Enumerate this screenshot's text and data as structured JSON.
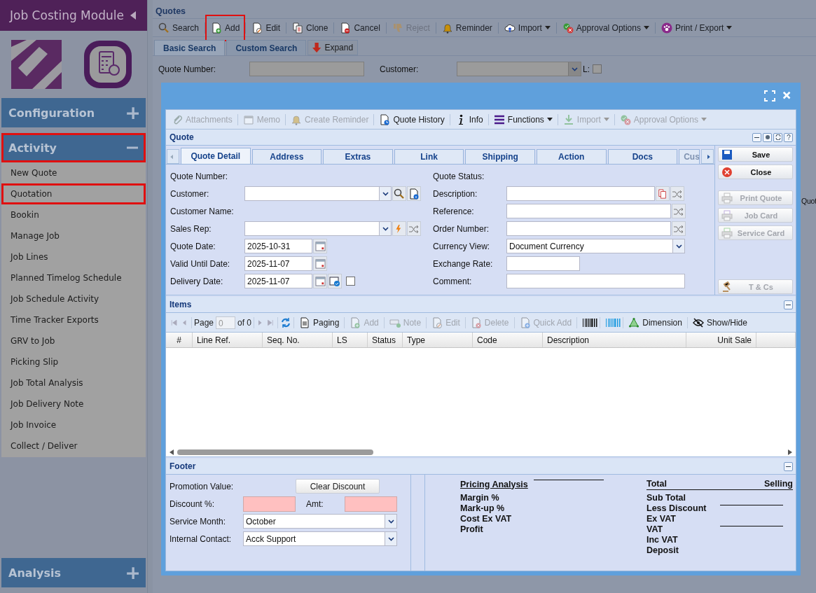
{
  "sidebar": {
    "title": "Job Costing Module",
    "sections": [
      {
        "label": "Configuration",
        "expanded": false,
        "highlighted": false
      },
      {
        "label": "Activity",
        "expanded": true,
        "highlighted": true,
        "items": [
          {
            "label": "New Quote",
            "highlighted": false
          },
          {
            "label": "Quotation",
            "highlighted": true
          },
          {
            "label": "Bookin",
            "highlighted": false
          },
          {
            "label": "Manage Job",
            "highlighted": false
          },
          {
            "label": "Job Lines",
            "highlighted": false
          },
          {
            "label": "Planned Timelog Schedule",
            "highlighted": false
          },
          {
            "label": "Job Schedule Activity",
            "highlighted": false
          },
          {
            "label": "Time Tracker Exports",
            "highlighted": false
          },
          {
            "label": "GRV to Job",
            "highlighted": false
          },
          {
            "label": "Picking Slip",
            "highlighted": false
          },
          {
            "label": "Job Total Analysis",
            "highlighted": false
          },
          {
            "label": "Job Delivery Note",
            "highlighted": false
          },
          {
            "label": "Job Invoice",
            "highlighted": false
          },
          {
            "label": "Collect / Deliver",
            "highlighted": false
          }
        ]
      },
      {
        "label": "Analysis",
        "expanded": false,
        "highlighted": false
      }
    ]
  },
  "main": {
    "title": "Quotes",
    "toolbar": [
      {
        "label": "Search",
        "disabled": false,
        "dropdown": false,
        "highlighted": false
      },
      {
        "label": "Add",
        "disabled": false,
        "dropdown": false,
        "highlighted": true
      },
      {
        "label": "Edit",
        "disabled": false,
        "dropdown": false,
        "highlighted": false
      },
      {
        "label": "Clone",
        "disabled": false,
        "dropdown": false,
        "highlighted": false
      },
      {
        "label": "Cancel",
        "disabled": false,
        "dropdown": false,
        "highlighted": false
      },
      {
        "label": "Reject",
        "disabled": true,
        "dropdown": false,
        "highlighted": false
      },
      {
        "label": "Reminder",
        "disabled": false,
        "dropdown": false,
        "highlighted": false
      },
      {
        "label": "Import",
        "disabled": false,
        "dropdown": true,
        "highlighted": false
      },
      {
        "label": "Approval Options",
        "disabled": false,
        "dropdown": true,
        "highlighted": false
      },
      {
        "label": "Print / Export",
        "disabled": false,
        "dropdown": true,
        "highlighted": false
      }
    ],
    "search_tabs": [
      {
        "label": "Basic Search",
        "selected": true
      },
      {
        "label": "Custom Search",
        "selected": false
      }
    ],
    "expand_button": "Expand",
    "search_form": {
      "quote_number_label": "Quote Number:",
      "customer_label": "Customer:",
      "l_label": "L:",
      "l_checked": false
    },
    "cut_column": "Quot"
  },
  "dialog": {
    "toolbar": [
      {
        "label": "Attachments",
        "disabled": true,
        "dropdown": false
      },
      {
        "label": "Memo",
        "disabled": true,
        "dropdown": false
      },
      {
        "label": "Create Reminder",
        "disabled": true,
        "dropdown": false
      },
      {
        "label": "Quote History",
        "disabled": false,
        "dropdown": false
      },
      {
        "label": "Info",
        "disabled": false,
        "dropdown": false
      },
      {
        "label": "Functions",
        "disabled": false,
        "dropdown": true
      },
      {
        "label": "Import",
        "disabled": true,
        "dropdown": true
      },
      {
        "label": "Approval Options",
        "disabled": true,
        "dropdown": true
      }
    ],
    "quote_panel": {
      "title": "Quote",
      "tabs": [
        {
          "label": "Quote Detail",
          "selected": true
        },
        {
          "label": "Address",
          "selected": false
        },
        {
          "label": "Extras",
          "selected": false
        },
        {
          "label": "Link",
          "selected": false
        },
        {
          "label": "Shipping",
          "selected": false
        },
        {
          "label": "Action",
          "selected": false
        },
        {
          "label": "Docs",
          "selected": false
        },
        {
          "label": "Cus",
          "selected": false
        }
      ],
      "left_fields": [
        {
          "kind": "label",
          "label": "Quote Number:"
        },
        {
          "kind": "combo",
          "label": "Customer:"
        },
        {
          "kind": "label",
          "label": "Customer Name:"
        },
        {
          "kind": "combo",
          "label": "Sales Rep:"
        },
        {
          "kind": "date",
          "label": "Quote Date:",
          "value": "2025-10-31"
        },
        {
          "kind": "date",
          "label": "Valid Until Date:",
          "value": "2025-11-07"
        },
        {
          "kind": "date",
          "label": "Delivery Date:",
          "value": "2025-11-07",
          "checked": false
        }
      ],
      "right_fields": [
        {
          "kind": "label",
          "label": "Quote Status:"
        },
        {
          "kind": "text",
          "label": "Description:"
        },
        {
          "kind": "text",
          "label": "Reference:"
        },
        {
          "kind": "text",
          "label": "Order Number:"
        },
        {
          "kind": "select",
          "label": "Currency View:",
          "value": "Document Currency"
        },
        {
          "kind": "short",
          "label": "Exchange Rate:"
        },
        {
          "kind": "wide",
          "label": "Comment:"
        }
      ],
      "side_buttons": [
        {
          "label": "Save",
          "disabled": false
        },
        {
          "label": "Close",
          "disabled": false
        },
        {
          "label": "Print Quote",
          "disabled": true
        },
        {
          "label": "Job Card",
          "disabled": true
        },
        {
          "label": "Service Card",
          "disabled": true
        },
        {
          "label": "T & Cs",
          "disabled": true
        }
      ]
    },
    "items_panel": {
      "title": "Items",
      "page_label": "Page",
      "page": "0",
      "page_of": "of 0",
      "toolbar": [
        {
          "label": "Paging",
          "disabled": false
        },
        {
          "label": "Add",
          "disabled": true
        },
        {
          "label": "Note",
          "disabled": true
        },
        {
          "label": "Edit",
          "disabled": true
        },
        {
          "label": "Delete",
          "disabled": true
        },
        {
          "label": "Quick Add",
          "disabled": true
        },
        {
          "label": "Dimension",
          "disabled": false
        },
        {
          "label": "Show/Hide",
          "disabled": false
        }
      ],
      "columns": [
        "#",
        "Line Ref.",
        "Seq. No.",
        "LS",
        "Status",
        "Type",
        "Code",
        "Description",
        "Unit Sale"
      ]
    },
    "footer_panel": {
      "title": "Footer",
      "promotion_label": "Promotion Value:",
      "clear_button": "Clear Discount",
      "discount_label": "Discount %:",
      "amt_label": "Amt:",
      "service_month_label": "Service Month:",
      "service_month": "October",
      "contact_label": "Internal Contact:",
      "contact": "Acck Support",
      "pricing_title": "Pricing Analysis",
      "pricing_rows": [
        "Margin %",
        "Mark-up %",
        "Cost Ex VAT",
        "Profit"
      ],
      "total_title": "Total",
      "selling_title": "Selling",
      "total_rows": [
        "Sub Total",
        "Less Discount",
        "Ex VAT",
        "VAT",
        "Inc VAT",
        "Deposit"
      ]
    }
  }
}
